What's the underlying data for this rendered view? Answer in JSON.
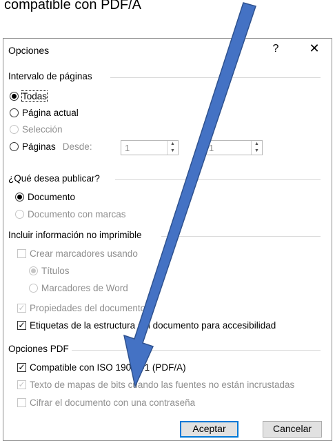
{
  "caption": "compatible con PDF/A",
  "dialog": {
    "title": "Opciones",
    "help_label": "?",
    "close_label": "✕"
  },
  "page_range": {
    "heading": "Intervalo de páginas",
    "options": [
      {
        "label": "Todas",
        "checked": true,
        "enabled": true
      },
      {
        "label": "Página actual",
        "checked": false,
        "enabled": true
      },
      {
        "label": "Selección",
        "checked": false,
        "enabled": false
      },
      {
        "label": "Páginas",
        "checked": false,
        "enabled": true
      }
    ],
    "from_label": "Desde:",
    "from_value": "1",
    "to_value": "1"
  },
  "publish": {
    "heading": "¿Qué desea publicar?",
    "options": [
      {
        "label": "Documento",
        "checked": true,
        "enabled": true
      },
      {
        "label": "Documento con marcas",
        "checked": false,
        "enabled": false
      }
    ]
  },
  "nonprint": {
    "heading": "Incluir información no imprimible",
    "create_bookmarks": "Crear marcadores usando",
    "bookmark_options": [
      "Títulos",
      "Marcadores de Word"
    ],
    "doc_properties": "Propiedades del documento",
    "structure_tags": "Etiquetas de la estructura del documento para accesibilidad"
  },
  "pdf_options": {
    "heading": "Opciones PDF",
    "iso": "Compatible con ISO 19005-1 (PDF/A)",
    "bitmap_text": "Texto de mapas de bits cuando las fuentes no están incrustadas",
    "encrypt": "Cifrar el documento con una contraseña"
  },
  "buttons": {
    "ok": "Aceptar",
    "cancel": "Cancelar"
  },
  "annotation": {
    "arrow_color": "#4472c4",
    "arrow_border": "#2f528f"
  }
}
